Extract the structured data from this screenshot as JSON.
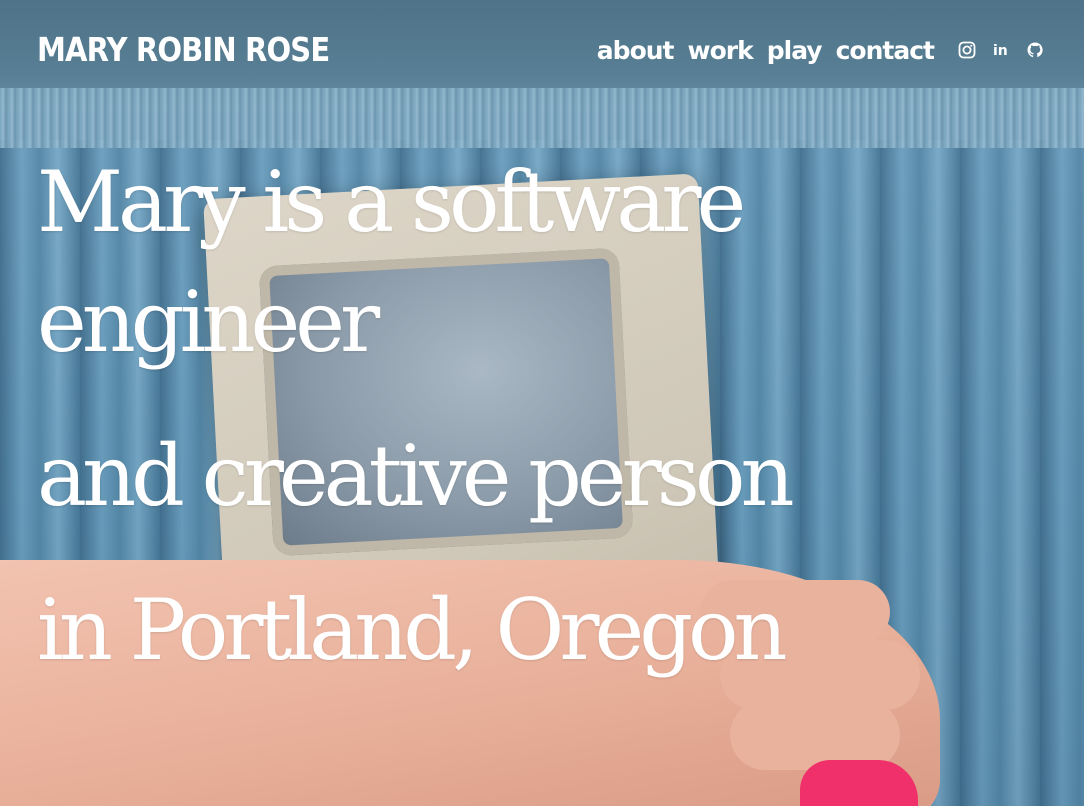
{
  "header": {
    "brand": "MARY ROBIN ROSE",
    "nav": [
      {
        "label": "about"
      },
      {
        "label": "work"
      },
      {
        "label": "play"
      },
      {
        "label": "contact"
      }
    ],
    "social_icons": [
      "instagram-icon",
      "linkedin-icon",
      "github-icon"
    ],
    "linkedin_glyph": "in"
  },
  "hero": {
    "line1": "Mary is a software",
    "line2": "engineer",
    "line3": "and creative person",
    "line4": "in Portland, Oregon"
  },
  "colors": {
    "text": "#ffffff",
    "curtain": "#5f8cac",
    "nail": "#f0306a"
  }
}
